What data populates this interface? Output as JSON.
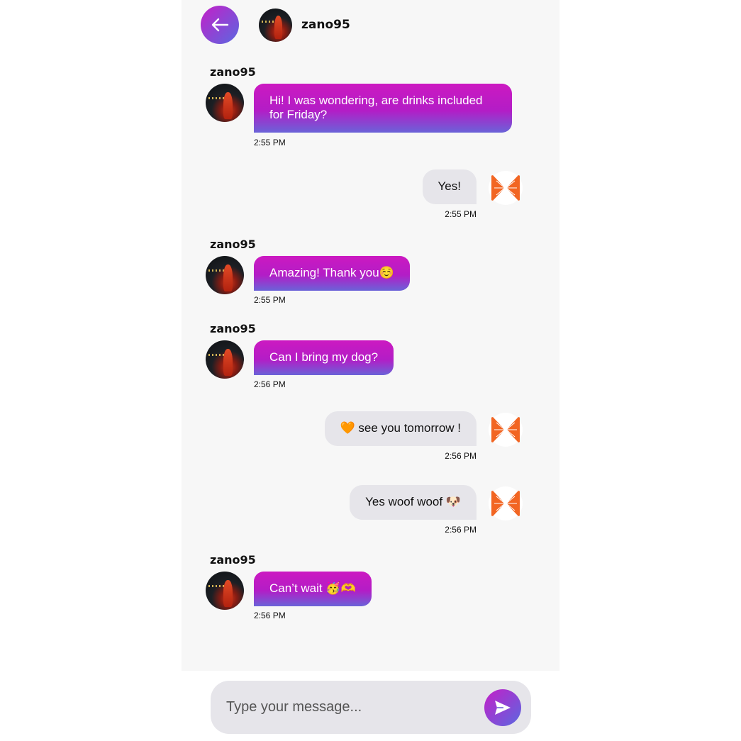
{
  "header": {
    "username": "zano95",
    "back_icon": "arrow-left-icon"
  },
  "messages": [
    {
      "direction": "incoming",
      "sender": "zano95",
      "text": "Hi! I was wondering, are drinks included for Friday?",
      "time": "2:55 PM"
    },
    {
      "direction": "outgoing",
      "text": "Yes!",
      "time": "2:55 PM"
    },
    {
      "direction": "incoming",
      "sender": "zano95",
      "text": "Amazing! Thank you☺️",
      "time": "2:55 PM"
    },
    {
      "direction": "incoming",
      "sender": "zano95",
      "text": "Can I bring my dog?",
      "time": "2:56 PM"
    },
    {
      "direction": "outgoing",
      "text": "🧡 see you tomorrow !",
      "time": "2:56 PM"
    },
    {
      "direction": "outgoing",
      "text": "Yes woof woof 🐶",
      "time": "2:56 PM"
    },
    {
      "direction": "incoming",
      "sender": "zano95",
      "text": "Can’t wait 🥳🫶",
      "time": "2:56 PM"
    }
  ],
  "composer": {
    "placeholder": "Type your message...",
    "send_icon": "send-icon"
  },
  "colors": {
    "accent_start": "#c41fc8",
    "accent_end": "#5a68e0",
    "outgoing_bubble": "#e6e5ea",
    "logo_orange": "#f26522"
  }
}
